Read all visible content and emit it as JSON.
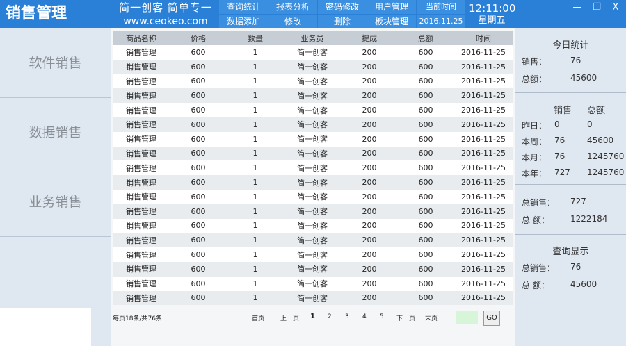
{
  "header": {
    "app_title": "销售管理",
    "slogan_line1": "简一创客   简单专一",
    "slogan_line2": "www.ceokeo.com",
    "nav_row1": [
      "查询统计",
      "报表分析",
      "密码修改",
      "用户管理",
      "当前时间"
    ],
    "nav_row2": [
      "数据添加",
      "修改",
      "删除",
      "板块管理",
      "2016.11.25"
    ],
    "time": "12:11:00",
    "weekday": "星期五",
    "window_controls": {
      "minimize": "—",
      "restore": "❐",
      "close": "X"
    },
    "colors": {
      "bar": "#2a7fd6",
      "button": "#3b8fe0"
    }
  },
  "sidebar": {
    "items": [
      "软件销售",
      "数据销售",
      "业务销售"
    ]
  },
  "table": {
    "columns": [
      "商品名称",
      "价格",
      "数量",
      "业务员",
      "提成",
      "总额",
      "时间"
    ],
    "rows": [
      [
        "销售管理",
        "600",
        "1",
        "简一创客",
        "200",
        "600",
        "2016-11-25"
      ],
      [
        "销售管理",
        "600",
        "1",
        "简一创客",
        "200",
        "600",
        "2016-11-25"
      ],
      [
        "销售管理",
        "600",
        "1",
        "简一创客",
        "200",
        "600",
        "2016-11-25"
      ],
      [
        "销售管理",
        "600",
        "1",
        "简一创客",
        "200",
        "600",
        "2016-11-25"
      ],
      [
        "销售管理",
        "600",
        "1",
        "简一创客",
        "200",
        "600",
        "2016-11-25"
      ],
      [
        "销售管理",
        "600",
        "1",
        "简一创客",
        "200",
        "600",
        "2016-11-25"
      ],
      [
        "销售管理",
        "600",
        "1",
        "简一创客",
        "200",
        "600",
        "2016-11-25"
      ],
      [
        "销售管理",
        "600",
        "1",
        "简一创客",
        "200",
        "600",
        "2016-11-25"
      ],
      [
        "销售管理",
        "600",
        "1",
        "简一创客",
        "200",
        "600",
        "2016-11-25"
      ],
      [
        "销售管理",
        "600",
        "1",
        "简一创客",
        "200",
        "600",
        "2016-11-25"
      ],
      [
        "销售管理",
        "600",
        "1",
        "简一创客",
        "200",
        "600",
        "2016-11-25"
      ],
      [
        "销售管理",
        "600",
        "1",
        "简一创客",
        "200",
        "600",
        "2016-11-25"
      ],
      [
        "销售管理",
        "600",
        "1",
        "简一创客",
        "200",
        "600",
        "2016-11-25"
      ],
      [
        "销售管理",
        "600",
        "1",
        "简一创客",
        "200",
        "600",
        "2016-11-25"
      ],
      [
        "销售管理",
        "600",
        "1",
        "简一创客",
        "200",
        "600",
        "2016-11-25"
      ],
      [
        "销售管理",
        "600",
        "1",
        "简一创客",
        "200",
        "600",
        "2016-11-25"
      ],
      [
        "销售管理",
        "600",
        "1",
        "简一创客",
        "200",
        "600",
        "2016-11-25"
      ],
      [
        "销售管理",
        "600",
        "1",
        "简一创客",
        "200",
        "600",
        "2016-11-25"
      ]
    ]
  },
  "pager": {
    "summary": "每页18条/共76条",
    "first": "首页",
    "prev": "上一页",
    "pages": [
      "1",
      "2",
      "3",
      "4",
      "5"
    ],
    "current": "1",
    "next": "下一页",
    "last": "末页",
    "input_value": "",
    "go": "GO"
  },
  "stats": {
    "today": {
      "title": "今日统计",
      "sales_label": "销售：",
      "sales": "76",
      "total_label": "总额：",
      "total": "45600"
    },
    "period": {
      "header_sales": "销售",
      "header_total": "总额",
      "rows": [
        {
          "label": "昨日：",
          "sales": "0",
          "total": "0"
        },
        {
          "label": "本周：",
          "sales": "76",
          "total": "45600"
        },
        {
          "label": "本月：",
          "sales": "76",
          "total": "1245760"
        },
        {
          "label": "本年：",
          "sales": "727",
          "total": "1245760"
        }
      ]
    },
    "overall": {
      "sales_label": "总销售：",
      "sales": "727",
      "total_label": "总  额：",
      "total": "1222184"
    },
    "query": {
      "title": "查询显示",
      "sales_label": "总销售：",
      "sales": "76",
      "total_label": "总  额：",
      "total": "45600"
    }
  }
}
